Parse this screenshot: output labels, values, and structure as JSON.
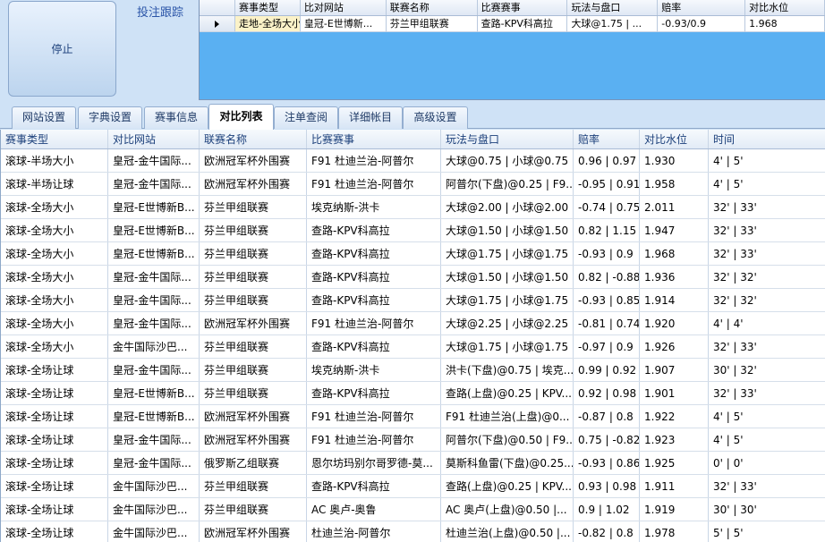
{
  "left_panel": {
    "stop_label": "停止",
    "track_label": "投注跟踪"
  },
  "top_grid": {
    "columns": [
      "赛事类型",
      "比对网站",
      "联赛名称",
      "比赛赛事",
      "玩法与盘口",
      "赔率",
      "对比水位"
    ],
    "rows": [
      [
        "走地-全场大小",
        "皇冠-E世博新...",
        "芬兰甲组联赛",
        "查路-KPV科高拉",
        "大球@1.75 | ...",
        "-0.93/0.9",
        "1.968"
      ]
    ]
  },
  "tabs": [
    "网站设置",
    "字典设置",
    "赛事信息",
    "对比列表",
    "注单查阅",
    "详细帐目",
    "高级设置"
  ],
  "active_tab": "对比列表",
  "table": {
    "columns": [
      "赛事类型",
      "对比网站",
      "联赛名称",
      "比赛赛事",
      "玩法与盘口",
      "赔率",
      "对比水位",
      "时间"
    ],
    "rows": [
      [
        "滚球-半场大小",
        "皇冠-金牛国际...",
        "欧洲冠军杯外围赛",
        "F91 杜迪兰治-阿普尔",
        "大球@0.75 | 小球@0.75",
        "0.96 | 0.97",
        "1.930",
        "4' | 5'"
      ],
      [
        "滚球-半场让球",
        "皇冠-金牛国际...",
        "欧洲冠军杯外围赛",
        "F91 杜迪兰治-阿普尔",
        "阿普尔(下盘)@0.25 | F9...",
        "-0.95 | 0.91",
        "1.958",
        "4' | 5'"
      ],
      [
        "滚球-全场大小",
        "皇冠-E世博新B...",
        "芬兰甲组联赛",
        "埃克纳斯-洪卡",
        "大球@2.00 | 小球@2.00",
        "-0.74 | 0.75",
        "2.011",
        "32' | 33'"
      ],
      [
        "滚球-全场大小",
        "皇冠-E世博新B...",
        "芬兰甲组联赛",
        "查路-KPV科高拉",
        "大球@1.50 | 小球@1.50",
        "0.82 | 1.15",
        "1.947",
        "32' | 33'"
      ],
      [
        "滚球-全场大小",
        "皇冠-E世博新B...",
        "芬兰甲组联赛",
        "查路-KPV科高拉",
        "大球@1.75 | 小球@1.75",
        "-0.93 | 0.9",
        "1.968",
        "32' | 33'"
      ],
      [
        "滚球-全场大小",
        "皇冠-金牛国际...",
        "芬兰甲组联赛",
        "查路-KPV科高拉",
        "大球@1.50 | 小球@1.50",
        "0.82 | -0.88",
        "1.936",
        "32' | 32'"
      ],
      [
        "滚球-全场大小",
        "皇冠-金牛国际...",
        "芬兰甲组联赛",
        "查路-KPV科高拉",
        "大球@1.75 | 小球@1.75",
        "-0.93 | 0.85",
        "1.914",
        "32' | 32'"
      ],
      [
        "滚球-全场大小",
        "皇冠-金牛国际...",
        "欧洲冠军杯外围赛",
        "F91 杜迪兰治-阿普尔",
        "大球@2.25 | 小球@2.25",
        "-0.81 | 0.74",
        "1.920",
        "4' | 4'"
      ],
      [
        "滚球-全场大小",
        "金牛国际沙巴...",
        "芬兰甲组联赛",
        "查路-KPV科高拉",
        "大球@1.75 | 小球@1.75",
        "-0.97 | 0.9",
        "1.926",
        "32' | 33'"
      ],
      [
        "滚球-全场让球",
        "皇冠-金牛国际...",
        "芬兰甲组联赛",
        "埃克纳斯-洪卡",
        "洪卡(下盘)@0.75 | 埃克...",
        "0.99 | 0.92",
        "1.907",
        "30' | 32'"
      ],
      [
        "滚球-全场让球",
        "皇冠-E世博新B...",
        "芬兰甲组联赛",
        "查路-KPV科高拉",
        "查路(上盘)@0.25 | KPV...",
        "0.92 | 0.98",
        "1.901",
        "32' | 33'"
      ],
      [
        "滚球-全场让球",
        "皇冠-E世博新B...",
        "欧洲冠军杯外围赛",
        "F91 杜迪兰治-阿普尔",
        "F91 杜迪兰治(上盘)@0...",
        "-0.87 | 0.8",
        "1.922",
        "4' | 5'"
      ],
      [
        "滚球-全场让球",
        "皇冠-金牛国际...",
        "欧洲冠军杯外围赛",
        "F91 杜迪兰治-阿普尔",
        "阿普尔(下盘)@0.50 | F9...",
        "0.75 | -0.82",
        "1.923",
        "4' | 5'"
      ],
      [
        "滚球-全场让球",
        "皇冠-金牛国际...",
        "俄罗斯乙组联赛",
        "恩尔坊玛别尔哥罗德-莫...",
        "莫斯科鱼雷(下盘)@0.25...",
        "-0.93 | 0.86",
        "1.925",
        "0' | 0'"
      ],
      [
        "滚球-全场让球",
        "金牛国际沙巴...",
        "芬兰甲组联赛",
        "查路-KPV科高拉",
        "查路(上盘)@0.25 | KPV...",
        "0.93 | 0.98",
        "1.911",
        "32' | 33'"
      ],
      [
        "滚球-全场让球",
        "金牛国际沙巴...",
        "芬兰甲组联赛",
        "AC 奥卢-奥鲁",
        "AC 奥卢(上盘)@0.50 |...",
        "0.9 | 1.02",
        "1.919",
        "30' | 30'"
      ],
      [
        "滚球-全场让球",
        "金牛国际沙巴...",
        "欧洲冠军杯外围赛",
        "杜迪兰治-阿普尔",
        "杜迪兰治(上盘)@0.50 |...",
        "-0.82 | 0.8",
        "1.978",
        "5' | 5'"
      ]
    ]
  }
}
